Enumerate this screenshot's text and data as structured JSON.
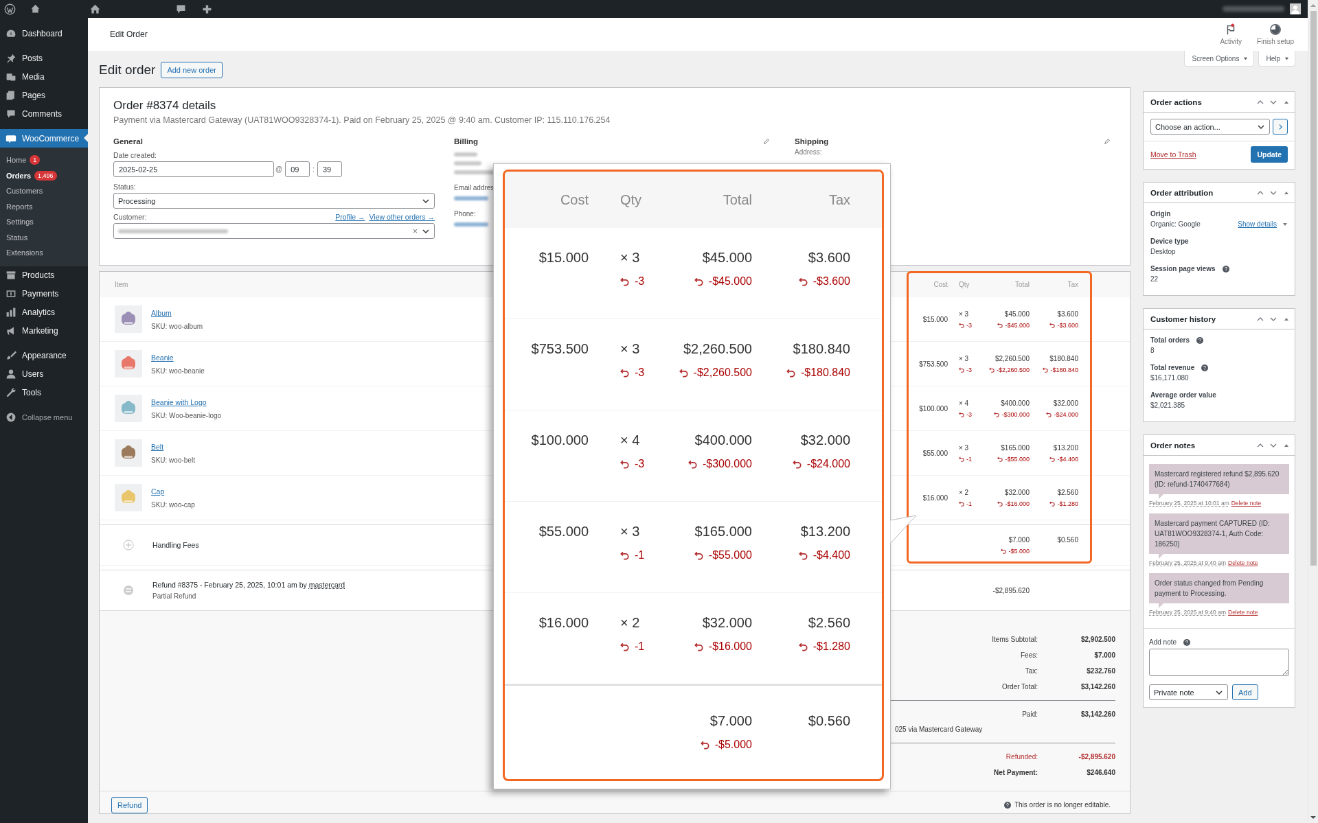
{
  "header": {
    "title": "Edit Order",
    "actions": [
      {
        "label": "Activity",
        "kind": "activity"
      },
      {
        "label": "Finish setup",
        "kind": "setup"
      }
    ]
  },
  "sidebar": {
    "sections": [
      {
        "items": [
          {
            "label": "Dashboard",
            "selected": false
          }
        ]
      },
      {
        "items": [
          {
            "label": "Posts",
            "selected": false
          },
          {
            "label": "Media",
            "selected": false
          },
          {
            "label": "Pages",
            "selected": false
          },
          {
            "label": "Comments",
            "selected": false
          }
        ]
      },
      {
        "items": [
          {
            "label": "WooCommerce",
            "selected": true,
            "children": [
              {
                "label": "Home",
                "badge": "1",
                "selected": false
              },
              {
                "label": "Orders",
                "badge": "1,496",
                "selected": true
              },
              {
                "label": "Customers",
                "selected": false
              },
              {
                "label": "Reports",
                "selected": false
              },
              {
                "label": "Settings",
                "selected": false
              },
              {
                "label": "Status",
                "selected": false
              },
              {
                "label": "Extensions",
                "selected": false
              }
            ]
          },
          {
            "label": "Products",
            "selected": false
          },
          {
            "label": "Payments",
            "selected": false
          },
          {
            "label": "Analytics",
            "selected": false
          },
          {
            "label": "Marketing",
            "selected": false
          }
        ]
      },
      {
        "items": [
          {
            "label": "Appearance",
            "selected": false
          },
          {
            "label": "Users",
            "selected": false
          },
          {
            "label": "Tools",
            "selected": false
          }
        ]
      }
    ],
    "collapse_label": "Collapse menu"
  },
  "page": {
    "title": "Edit order",
    "add_button": "Add new order",
    "screen_options": "Screen Options",
    "help": "Help"
  },
  "order": {
    "heading": "Order #8374 details",
    "meta": "Payment via Mastercard Gateway (UAT81WOO9328374-1). Paid on February 25, 2025 @ 9:40 am. Customer IP: 115.110.176.254",
    "general": {
      "heading": "General",
      "date_label": "Date created:",
      "date": "2025-02-25",
      "at": "@",
      "hour": "09",
      "sep": ":",
      "minute": "39",
      "status_label": "Status:",
      "status": "Processing",
      "customer_label": "Customer:",
      "profile_link": "Profile →",
      "orders_link": "View other orders →",
      "clear": "×"
    },
    "billing": {
      "heading": "Billing",
      "email_label": "Email addres",
      "phone_label": "Phone:"
    },
    "shipping": {
      "heading": "Shipping",
      "address_label": "Address:"
    }
  },
  "items": {
    "column_item": "Item",
    "columns": [
      "Cost",
      "Qty",
      "Total",
      "Tax"
    ],
    "rows": [
      {
        "name": "Album",
        "sku": "SKU: woo-album",
        "cost": "$15.000",
        "qty": "× 3",
        "total": "$45.000",
        "tax": "$3.600",
        "refund_qty": "-3",
        "refund_total": "-$45.000",
        "refund_tax": "-$3.600"
      },
      {
        "name": "Beanie",
        "sku": "SKU: woo-beanie",
        "cost": "$753.500",
        "qty": "× 3",
        "total": "$2,260.500",
        "tax": "$180.840",
        "refund_qty": "-3",
        "refund_total": "-$2,260.500",
        "refund_tax": "-$180.840"
      },
      {
        "name": "Beanie with Logo",
        "sku": "SKU: Woo-beanie-logo",
        "cost": "$100.000",
        "qty": "× 4",
        "total": "$400.000",
        "tax": "$32.000",
        "refund_qty": "-3",
        "refund_total": "-$300.000",
        "refund_tax": "-$24.000"
      },
      {
        "name": "Belt",
        "sku": "SKU: woo-belt",
        "cost": "$55.000",
        "qty": "× 3",
        "total": "$165.000",
        "tax": "$13.200",
        "refund_qty": "-1",
        "refund_total": "-$55.000",
        "refund_tax": "-$4.400"
      },
      {
        "name": "Cap",
        "sku": "SKU: woo-cap",
        "cost": "$16.000",
        "qty": "× 2",
        "total": "$32.000",
        "tax": "$2.560",
        "refund_qty": "-1",
        "refund_total": "-$16.000",
        "refund_tax": "-$1.280"
      }
    ],
    "fee": {
      "name": "Handling Fees",
      "total": "$7.000",
      "tax": "$0.560",
      "refund_total": "-$5.000"
    },
    "refund": {
      "title": "Refund #8375 - February 25, 2025, 10:01 am by ",
      "author": "mastercard",
      "subtitle": "Partial Refund",
      "amount": "-$2,895.620"
    },
    "totals": {
      "order": [
        {
          "label": "Items Subtotal:",
          "value": "$2,902.500"
        },
        {
          "label": "Fees:",
          "value": "$7.000"
        },
        {
          "label": "Tax:",
          "value": "$232.760"
        },
        {
          "label": "Order Total:",
          "value": "$3,142.260"
        }
      ],
      "paid": {
        "label": "Paid:",
        "value": "$3,142.260",
        "note": "025 via Mastercard Gateway"
      },
      "refunded": {
        "label": "Refunded:",
        "value": "-$2,895.620"
      },
      "net": {
        "label": "Net Payment:",
        "value": "$246.640"
      }
    },
    "refund_button": "Refund",
    "locked_note": "This order is no longer editable."
  },
  "callout": {
    "columns": [
      "Cost",
      "Qty",
      "Total",
      "Tax"
    ],
    "rows": [
      {
        "cost": "$15.000",
        "qty": "× 3",
        "total": "$45.000",
        "tax": "$3.600",
        "refund_qty": "-3",
        "refund_total": "-$45.000",
        "refund_tax": "-$3.600"
      },
      {
        "cost": "$753.500",
        "qty": "× 3",
        "total": "$2,260.500",
        "tax": "$180.840",
        "refund_qty": "-3",
        "refund_total": "-$2,260.500",
        "refund_tax": "-$180.840"
      },
      {
        "cost": "$100.000",
        "qty": "× 4",
        "total": "$400.000",
        "tax": "$32.000",
        "refund_qty": "-3",
        "refund_total": "-$300.000",
        "refund_tax": "-$24.000"
      },
      {
        "cost": "$55.000",
        "qty": "× 3",
        "total": "$165.000",
        "tax": "$13.200",
        "refund_qty": "-1",
        "refund_total": "-$55.000",
        "refund_tax": "-$4.400"
      },
      {
        "cost": "$16.000",
        "qty": "× 2",
        "total": "$32.000",
        "tax": "$2.560",
        "refund_qty": "-1",
        "refund_total": "-$16.000",
        "refund_tax": "-$1.280"
      }
    ],
    "fee": {
      "total": "$7.000",
      "tax": "$0.560",
      "refund_total": "-$5.000"
    }
  },
  "panels": {
    "actions": {
      "title": "Order actions",
      "select": "Choose an action...",
      "trash": "Move to Trash",
      "update": "Update"
    },
    "attribution": {
      "title": "Order attribution",
      "fields": [
        {
          "label": "Origin",
          "value": "Organic: Google",
          "link": "Show details",
          "help": false
        },
        {
          "label": "Device type",
          "value": "Desktop",
          "help": false
        },
        {
          "label": "Session page views",
          "value": "22",
          "help": true
        }
      ]
    },
    "history": {
      "title": "Customer history",
      "fields": [
        {
          "label": "Total orders",
          "value": "8",
          "help": true
        },
        {
          "label": "Total revenue",
          "value": "$16,171.080",
          "help": true
        },
        {
          "label": "Average order value",
          "value": "$2,021.385",
          "help": false
        }
      ]
    },
    "notes": {
      "title": "Order notes",
      "notes": [
        {
          "text": "Mastercard registered refund $2,895.620 (ID: refund-1740477684)",
          "date": "February 25, 2025 at 10:01 am",
          "delete": "Delete note"
        },
        {
          "text": "Mastercard payment CAPTURED (ID: UAT81WOO9328374-1, Auth Code: 186250)",
          "date": "February 25, 2025 at 9:40 am",
          "delete": "Delete note"
        },
        {
          "text": "Order status changed from Pending payment to Processing.",
          "date": "February 25, 2025 at 9:40 am",
          "delete": "Delete note"
        }
      ],
      "add_label": "Add note",
      "type": "Private note",
      "add_button": "Add"
    }
  }
}
